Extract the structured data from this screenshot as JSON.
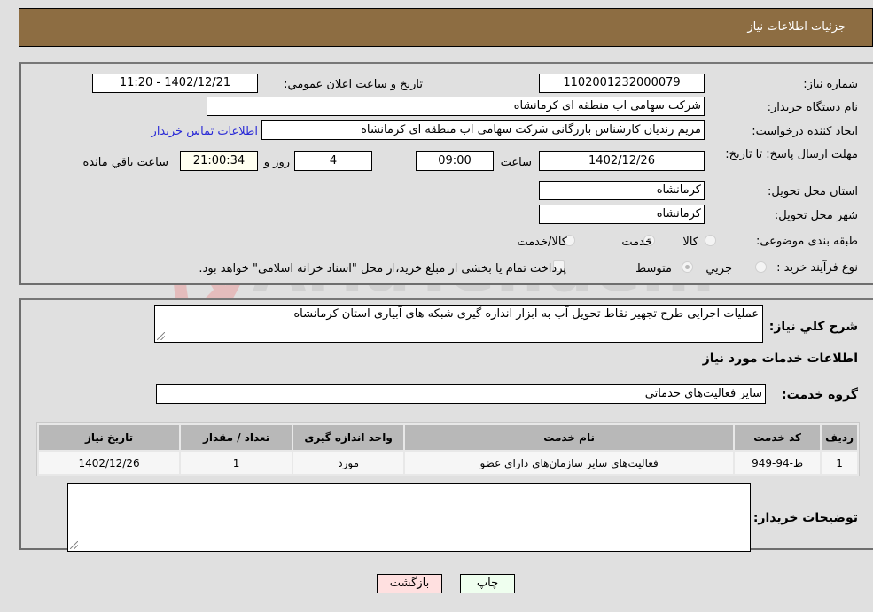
{
  "header": {
    "title": "جزئیات اطلاعات نیاز"
  },
  "form": {
    "need_number": {
      "label": "شماره نیاز:",
      "value": "1102001232000079"
    },
    "announce_datetime": {
      "label": "تاریخ و ساعت اعلان عمومي:",
      "value": "1402/12/21 - 11:20"
    },
    "buyer_org": {
      "label": "نام دستگاه خريدار:",
      "value": "شرکت سهامی اب منطقه ای کرمانشاه"
    },
    "requester": {
      "label": "ايجاد کننده درخواست:",
      "value": "مریم زندیان کارشناس بازرگانی شرکت سهامی اب منطقه ای کرمانشاه"
    },
    "buyer_contact_link": "اطلاعات تماس خريدار",
    "deadline": {
      "label": "مهلت ارسال پاسخ: تا تاريخ:",
      "date": "1402/12/26",
      "time_label": "ساعت",
      "time": "09:00",
      "days": "4",
      "days_label": "روز و",
      "remaining": "21:00:34",
      "remaining_label": "ساعت باقي مانده"
    },
    "delivery_province": {
      "label": "استان محل تحويل:",
      "value": "کرمانشاه"
    },
    "delivery_city": {
      "label": "شهر محل تحويل:",
      "value": "کرمانشاه"
    },
    "category": {
      "label": "طبقه بندی موضوعی:",
      "options": [
        "کالا",
        "خدمت",
        "کالا/خدمت"
      ],
      "selected": "خدمت"
    },
    "purchase_type": {
      "label": "نوع فرآيند خريد :",
      "options": [
        "جزيي",
        "متوسط"
      ],
      "selected": "متوسط",
      "treasury_note": "پرداخت تمام يا بخشی از مبلغ خريد،از محل \"اسناد خزانه اسلامی\" خواهد بود.",
      "treasury_checked": false
    }
  },
  "details": {
    "description_label": "شرح کلي نياز:",
    "description": "عملیات اجرایی طرح تجهیز نقاط تحویل آب به ابزار اندازه گیری شبکه های آبیاری استان کرمانشاه",
    "services_heading": "اطلاعات خدمات مورد نياز",
    "service_group_label": "گروه خدمت:",
    "service_group": "سایر فعالیت‌های خدماتی",
    "table": {
      "headers": [
        "رديف",
        "کد خدمت",
        "نام خدمت",
        "واحد اندازه گيری",
        "تعداد / مقدار",
        "تاريخ نياز"
      ],
      "rows": [
        [
          "1",
          "ط-94-949",
          "فعالیت‌های سایر سازمان‌های دارای عضو",
          "مورد",
          "1",
          "1402/12/26"
        ]
      ]
    },
    "buyer_notes_label": "توضيحات خريدار:",
    "buyer_notes": ""
  },
  "buttons": {
    "back": "بازگشت",
    "print": "چاپ"
  },
  "watermark": "AriaTender.neT",
  "colors": {
    "header_bg": "#8d6d42",
    "link": "#2a2ad6",
    "back_btn": "#ffe0e0",
    "print_btn": "#efffef"
  }
}
